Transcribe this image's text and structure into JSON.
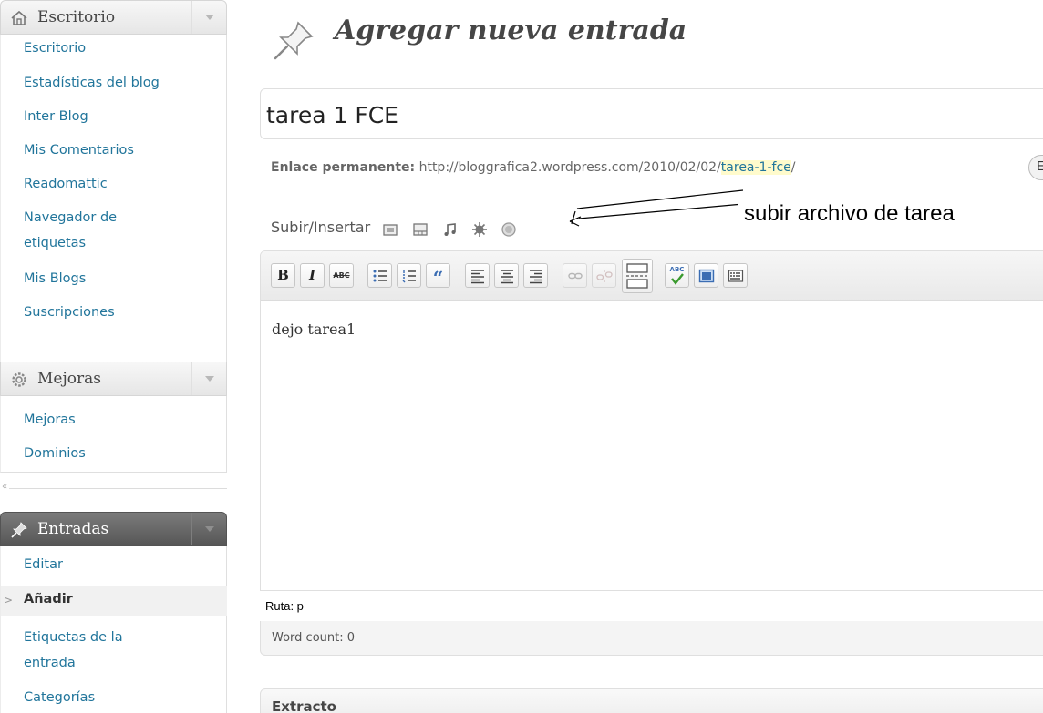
{
  "sidebar": {
    "escritorio": {
      "title": "Escritorio",
      "items": [
        "Escritorio",
        "Estadísticas del blog",
        "Inter Blog",
        "Mis Comentarios",
        "Readomattic",
        "Navegador de",
        "etiquetas",
        "Mis Blogs",
        "Suscripciones"
      ]
    },
    "mejoras": {
      "title": "Mejoras",
      "items": [
        "Mejoras",
        "Dominios"
      ]
    },
    "collapse": "«",
    "entradas": {
      "title": "Entradas",
      "items": [
        "Editar",
        "Añadir",
        "Etiquetas de la",
        "entrada",
        "Categorías"
      ],
      "current": "Añadir"
    }
  },
  "main": {
    "page_title": "Agregar nueva entrada",
    "post_title": "tarea 1 FCE",
    "permalink": {
      "label": "Enlace permanente:",
      "base": "http://bloggrafica2.wordpress.com/2010/02/02/",
      "slug": "tarea-1-fce",
      "trail": "/",
      "edit_label": "Ed"
    },
    "media": {
      "label": "Subir/Insertar",
      "icons": [
        "image-icon",
        "gallery-icon",
        "music-icon",
        "media-icon",
        "poll-icon"
      ]
    },
    "annotation": "subir archivo de tarea",
    "toolbar_icons": [
      "bold",
      "italic",
      "strikethrough",
      "bullet-list",
      "numbered-list",
      "blockquote",
      "align-left",
      "align-center",
      "align-right",
      "link",
      "unlink",
      "more",
      "spellcheck",
      "fullscreen",
      "kitchen-sink"
    ],
    "toolbar_text": {
      "bold": "B",
      "italic": "I",
      "strike": "ABC",
      "quote": "“",
      "spell": "ABC"
    },
    "content": "dejo tarea1",
    "path": "Ruta: p",
    "word_count": "Word count: 0",
    "excerpt_title": "Extracto"
  },
  "colors": {
    "link": "#21759b",
    "slug_highlight": "#fffbcc",
    "dark_menu": "#5a5a5a"
  }
}
